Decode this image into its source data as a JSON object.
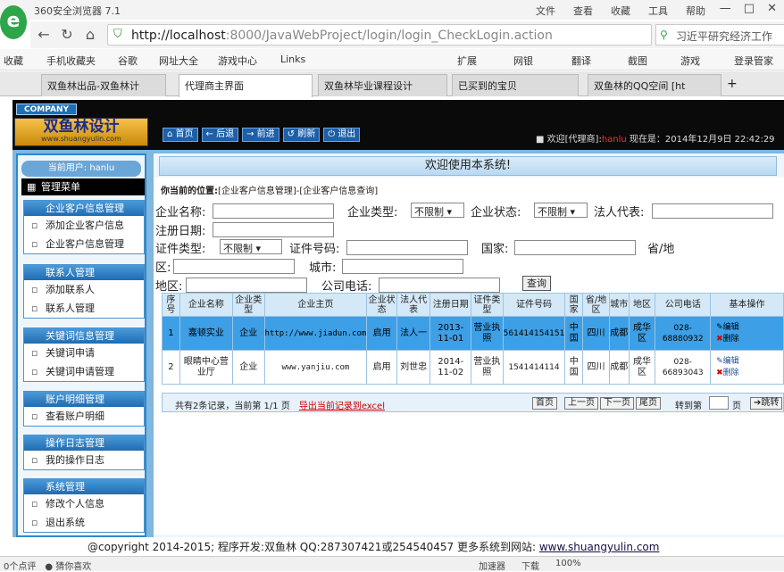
{
  "browser": {
    "title": "360安全浏览器 7.1",
    "menu": [
      "文件",
      "查看",
      "收藏",
      "工具",
      "帮助"
    ],
    "url_host": "http://localhost",
    "url_rest": ":8000/JavaWebProject/login/login_CheckLogin.action",
    "search_text": "习近平研究经济工作",
    "favorites": [
      "收藏",
      "手机收藏夹",
      "谷歌",
      "网址大全",
      "游戏中心",
      "Links",
      "扩展",
      "网银",
      "翻译",
      "截图",
      "游戏",
      "登录管家"
    ],
    "tabs": [
      "双鱼林出品-双鱼林计",
      "代理商主界面",
      "双鱼林毕业课程设计",
      "已买到的宝贝",
      "双鱼林的QQ空间 [ht"
    ],
    "status_left": "0个点评",
    "status_left2": "猜你喜欢",
    "status_right": [
      "加速器",
      "下载",
      "",
      "100%"
    ]
  },
  "header": {
    "company": "COMPANY",
    "brand_title": "双鱼林设计",
    "brand_url": "www.shuangyulin.com",
    "nav": [
      "首页",
      "后退",
      "前进",
      "刷新",
      "退出"
    ],
    "welcome_prefix": "欢迎[代理商]:",
    "welcome_user": "hanlu",
    "welcome_time": " 现在是：2014年12月9日 22:42:29"
  },
  "sidebar": {
    "current_user": "当前用户: hanlu",
    "menu_title": "管理菜单",
    "groups": [
      {
        "title": "企业客户信息管理",
        "items": [
          "添加企业客户信息",
          "企业客户信息管理"
        ]
      },
      {
        "title": "联系人管理",
        "items": [
          "添加联系人",
          "联系人管理"
        ]
      },
      {
        "title": "关键词信息管理",
        "items": [
          "关键词申请",
          "关键词申请管理"
        ]
      },
      {
        "title": "账户明细管理",
        "items": [
          "查看账户明细"
        ]
      },
      {
        "title": "操作日志管理",
        "items": [
          "我的操作日志"
        ]
      },
      {
        "title": "系统管理",
        "items": [
          "修改个人信息",
          "退出系统"
        ]
      }
    ]
  },
  "main": {
    "welcome": "欢迎使用本系统!",
    "crumb_label": "你当前的位置:",
    "crumb_path": "[企业客户信息管理]-[企业客户信息查询]",
    "form": {
      "name": "企业名称:",
      "type": "企业类型:",
      "type_val": "不限制",
      "state": "企业状态:",
      "state_val": "不限制",
      "legal": "法人代表:",
      "reg_date": "注册日期:",
      "cert_type": "证件类型:",
      "cert_type_val": "不限制",
      "cert_no": "证件号码:",
      "country": "国家:",
      "province": "省/地",
      "district_area": "区:",
      "city": "城市:",
      "region": "地区:",
      "phone": "公司电话:",
      "query": "查询"
    },
    "columns": [
      "序号",
      "企业名称",
      "企业类型",
      "企业主页",
      "企业状态",
      "法人代表",
      "注册日期",
      "证件类型",
      "证件号码",
      "国家",
      "省/地区",
      "城市",
      "地区",
      "公司电话",
      "基本操作"
    ],
    "rows": [
      [
        "1",
        "嘉顿实业",
        "企业",
        "http://www.jiadun.com",
        "启用",
        "法人一",
        "2013-11-01",
        "营业执照",
        "561414154151",
        "中国",
        "四川",
        "成都",
        "成华区",
        "028-68880932"
      ],
      [
        "2",
        "眼睛中心营业厅",
        "企业",
        "www.yanjiu.com",
        "启用",
        "刘世忠",
        "2014-11-02",
        "营业执照",
        "1541414114",
        "中国",
        "四川",
        "成都",
        "成华区",
        "028-66893043"
      ]
    ],
    "op_edit": "编辑",
    "op_del": "删除",
    "pager_info": "共有2条记录，当前第 1/1 页",
    "pager_export": "导出当前记录到excel",
    "pager_buttons": [
      "首页",
      "上一页",
      "下一页",
      "尾页"
    ],
    "pager_goto": "转到第",
    "pager_page": "页",
    "pager_go": "跳转"
  },
  "footer": {
    "text": "@copyright 2014-2015; 程序开发:双鱼林  QQ:287307421或254540457  更多系统到网站: ",
    "link": "www.shuangyulin.com"
  },
  "colors": {
    "header_bg": "#0a0a0a",
    "highlight_row": "#3d9fe6",
    "sidebar_border": "#2f88c9"
  }
}
